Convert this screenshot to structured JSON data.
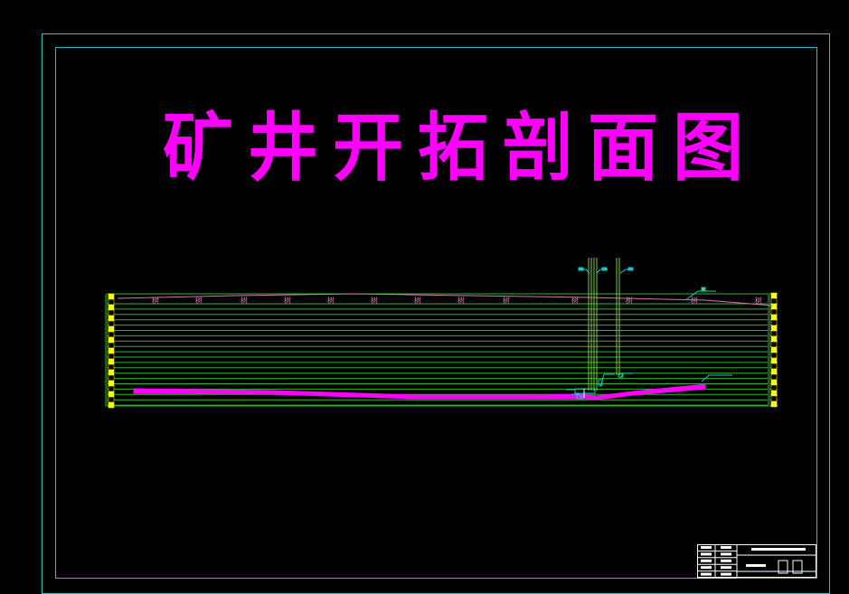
{
  "drawing": {
    "title": "矿井开拓剖面图",
    "colors": {
      "frame": "#19c6c6",
      "title": "#ff00ff",
      "strata": "#2fb52f",
      "terrain": "#d17aa6",
      "coal_seam": "#ff00ff",
      "shaft": "#7dcc3d",
      "annotation": "#19c6c6",
      "boundary_marker": "#ffff00",
      "title_block": "#ffffff"
    },
    "terrain_symbols": [
      "树",
      "树",
      "树",
      "树",
      "树",
      "树",
      "树",
      "树",
      "树",
      "树",
      "树",
      "树",
      "树",
      "树"
    ]
  }
}
